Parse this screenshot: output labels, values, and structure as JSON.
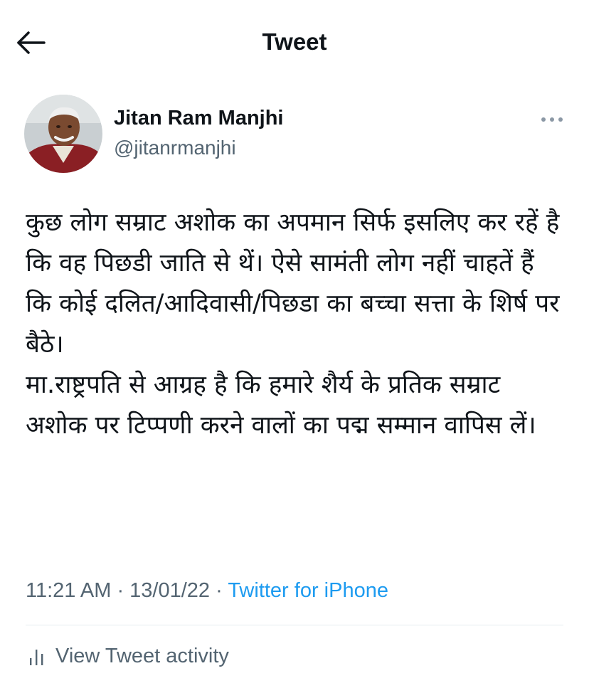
{
  "header": {
    "title": "Tweet",
    "back_icon": "arrow-left-icon"
  },
  "author": {
    "name": "Jitan Ram Manjhi",
    "handle": "@jitanrmanjhi",
    "avatar_icon": "profile-photo"
  },
  "tweet": {
    "paragraphs": [
      "कुछ लोग सम्राट अशोक का अपमान सिर्फ इसलिए कर रहें है कि वह पिछडी जाति से थें। ऐसे सामंती लोग नहीं चाहतें हैं कि कोई दलित/आदिवासी/पिछडा का बच्चा सत्ता के शिर्ष पर बैठे।",
      "मा.राष्ट्रपति से आग्रह है कि हमारे शैर्य के प्रतिक सम्राट अशोक पर टिप्पणी करने वालों का पद्म सम्मान वापिस लें।"
    ]
  },
  "meta": {
    "time": "11:21 AM",
    "date": "13/01/22",
    "separator": " · ",
    "source": "Twitter for iPhone"
  },
  "activity": {
    "label": "View Tweet activity",
    "icon": "bar-chart-icon"
  },
  "colors": {
    "text": "#0f1419",
    "secondary": "#536471",
    "link": "#1d9bf0",
    "divider": "#e6ecf0"
  }
}
